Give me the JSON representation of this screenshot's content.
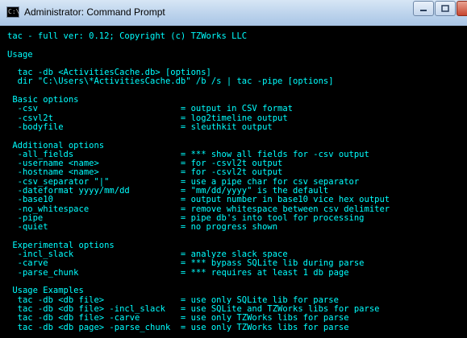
{
  "window": {
    "title": "Administrator: Command Prompt",
    "icon": "cmd-icon",
    "controls": [
      "minimize-icon",
      "maximize-icon",
      "close-icon"
    ]
  },
  "colors": {
    "console_bg": "#000000",
    "console_text": "#00ffff"
  },
  "console": {
    "lines": [
      "tac - full ver: 0.12; Copyright (c) TZWorks LLC",
      "",
      "Usage",
      "",
      "  tac -db <ActivitiesCache.db> [options]",
      "  dir \"C:\\Users\\*ActivitiesCache.db\" /b /s | tac -pipe [options]",
      "",
      " Basic options",
      "  -csv                            = output in CSV format",
      "  -csvl2t                         = log2timeline output",
      "  -bodyfile                       = sleuthkit output",
      "",
      " Additional options",
      "  -all_fields                     = *** show all fields for -csv output",
      "  -username <name>                = for -csvl2t output",
      "  -hostname <name>                = for -csvl2t output",
      "  -csv_separator \"|\"              = use a pipe char for csv separator",
      "  -dateformat yyyy/mm/dd          = \"mm/dd/yyyy\" is the default",
      "  -base10                         = output number in base10 vice hex output",
      "  -no_whitespace                  = remove whitespace between csv delimiter",
      "  -pipe                           = pipe db's into tool for processing",
      "  -quiet                          = no progress shown",
      "",
      " Experimental options",
      "  -incl_slack                     = analyze slack space",
      "  -carve                          = *** bypass SQLite lib during parse",
      "  -parse_chunk                    = *** requires at least 1 db page",
      "",
      " Usage Examples",
      "  tac -db <db file>               = use only SQLite lib for parse",
      "  tac -db <db file> -incl_slack   = use SQLite and TZWorks libs for parse",
      "  tac -db <db file> -carve        = use only TZWorks libs for parse",
      "  tac -db <db page> -parse_chunk  = use only TZWorks libs for parse"
    ]
  }
}
